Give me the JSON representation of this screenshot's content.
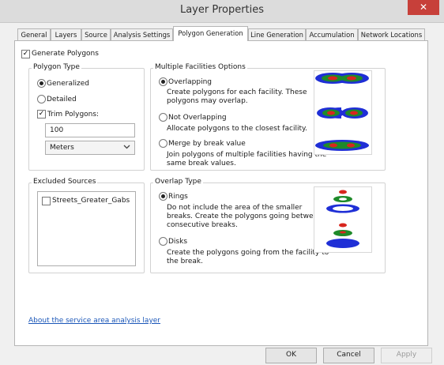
{
  "window": {
    "title": "Layer Properties",
    "close_glyph": "✕"
  },
  "tabs": [
    {
      "label": "General"
    },
    {
      "label": "Layers"
    },
    {
      "label": "Source"
    },
    {
      "label": "Analysis Settings"
    },
    {
      "label": "Polygon Generation",
      "active": true
    },
    {
      "label": "Line Generation"
    },
    {
      "label": "Accumulation"
    },
    {
      "label": "Network Locations"
    }
  ],
  "generate_polygons": {
    "label": "Generate Polygons",
    "checked": true
  },
  "polygon_type": {
    "title": "Polygon Type",
    "generalized": {
      "label": "Generalized",
      "selected": true
    },
    "detailed": {
      "label": "Detailed",
      "selected": false
    },
    "trim": {
      "label": "Trim Polygons:",
      "checked": true,
      "value": "100"
    },
    "units": {
      "value": "Meters"
    }
  },
  "multiple_facilities": {
    "title": "Multiple Facilities Options",
    "overlapping": {
      "label": "Overlapping",
      "selected": true,
      "desc1": "Create polygons for each facility. These",
      "desc2": "polygons may overlap."
    },
    "not_overlapping": {
      "label": "Not Overlapping",
      "selected": false,
      "desc1": "Allocate polygons to the closest facility."
    },
    "merge": {
      "label": "Merge by break value",
      "selected": false,
      "desc1": "Join polygons of multiple facilities having the",
      "desc2": "same break values."
    }
  },
  "excluded_sources": {
    "title": "Excluded Sources",
    "items": [
      {
        "label": "Streets_Greater_Gabs",
        "checked": false
      }
    ]
  },
  "overlap_type": {
    "title": "Overlap Type",
    "rings": {
      "label": "Rings",
      "selected": true,
      "desc1": "Do not include the area of the smaller",
      "desc2": "breaks. Create the polygons going between",
      "desc3": "consecutive breaks."
    },
    "disks": {
      "label": "Disks",
      "selected": false,
      "desc1": "Create the polygons going from the facility to",
      "desc2": "the break."
    }
  },
  "link": {
    "label": "About the service area analysis layer"
  },
  "buttons": {
    "ok": "OK",
    "cancel": "Cancel",
    "apply": "Apply"
  },
  "colors": {
    "close": "#c7403a",
    "link": "#1a56b8",
    "outer": "#1f2fd6",
    "mid": "#1f8a2a",
    "inner": "#d8261e"
  }
}
